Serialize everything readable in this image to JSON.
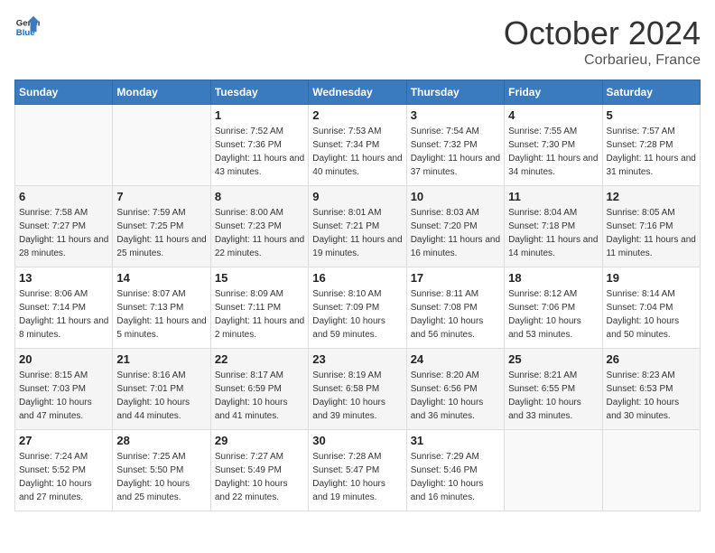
{
  "header": {
    "logo_line1": "General",
    "logo_line2": "Blue",
    "month": "October 2024",
    "location": "Corbarieu, France"
  },
  "weekdays": [
    "Sunday",
    "Monday",
    "Tuesday",
    "Wednesday",
    "Thursday",
    "Friday",
    "Saturday"
  ],
  "weeks": [
    [
      {
        "day": "",
        "sunrise": "",
        "sunset": "",
        "daylight": ""
      },
      {
        "day": "",
        "sunrise": "",
        "sunset": "",
        "daylight": ""
      },
      {
        "day": "1",
        "sunrise": "Sunrise: 7:52 AM",
        "sunset": "Sunset: 7:36 PM",
        "daylight": "Daylight: 11 hours and 43 minutes."
      },
      {
        "day": "2",
        "sunrise": "Sunrise: 7:53 AM",
        "sunset": "Sunset: 7:34 PM",
        "daylight": "Daylight: 11 hours and 40 minutes."
      },
      {
        "day": "3",
        "sunrise": "Sunrise: 7:54 AM",
        "sunset": "Sunset: 7:32 PM",
        "daylight": "Daylight: 11 hours and 37 minutes."
      },
      {
        "day": "4",
        "sunrise": "Sunrise: 7:55 AM",
        "sunset": "Sunset: 7:30 PM",
        "daylight": "Daylight: 11 hours and 34 minutes."
      },
      {
        "day": "5",
        "sunrise": "Sunrise: 7:57 AM",
        "sunset": "Sunset: 7:28 PM",
        "daylight": "Daylight: 11 hours and 31 minutes."
      }
    ],
    [
      {
        "day": "6",
        "sunrise": "Sunrise: 7:58 AM",
        "sunset": "Sunset: 7:27 PM",
        "daylight": "Daylight: 11 hours and 28 minutes."
      },
      {
        "day": "7",
        "sunrise": "Sunrise: 7:59 AM",
        "sunset": "Sunset: 7:25 PM",
        "daylight": "Daylight: 11 hours and 25 minutes."
      },
      {
        "day": "8",
        "sunrise": "Sunrise: 8:00 AM",
        "sunset": "Sunset: 7:23 PM",
        "daylight": "Daylight: 11 hours and 22 minutes."
      },
      {
        "day": "9",
        "sunrise": "Sunrise: 8:01 AM",
        "sunset": "Sunset: 7:21 PM",
        "daylight": "Daylight: 11 hours and 19 minutes."
      },
      {
        "day": "10",
        "sunrise": "Sunrise: 8:03 AM",
        "sunset": "Sunset: 7:20 PM",
        "daylight": "Daylight: 11 hours and 16 minutes."
      },
      {
        "day": "11",
        "sunrise": "Sunrise: 8:04 AM",
        "sunset": "Sunset: 7:18 PM",
        "daylight": "Daylight: 11 hours and 14 minutes."
      },
      {
        "day": "12",
        "sunrise": "Sunrise: 8:05 AM",
        "sunset": "Sunset: 7:16 PM",
        "daylight": "Daylight: 11 hours and 11 minutes."
      }
    ],
    [
      {
        "day": "13",
        "sunrise": "Sunrise: 8:06 AM",
        "sunset": "Sunset: 7:14 PM",
        "daylight": "Daylight: 11 hours and 8 minutes."
      },
      {
        "day": "14",
        "sunrise": "Sunrise: 8:07 AM",
        "sunset": "Sunset: 7:13 PM",
        "daylight": "Daylight: 11 hours and 5 minutes."
      },
      {
        "day": "15",
        "sunrise": "Sunrise: 8:09 AM",
        "sunset": "Sunset: 7:11 PM",
        "daylight": "Daylight: 11 hours and 2 minutes."
      },
      {
        "day": "16",
        "sunrise": "Sunrise: 8:10 AM",
        "sunset": "Sunset: 7:09 PM",
        "daylight": "Daylight: 10 hours and 59 minutes."
      },
      {
        "day": "17",
        "sunrise": "Sunrise: 8:11 AM",
        "sunset": "Sunset: 7:08 PM",
        "daylight": "Daylight: 10 hours and 56 minutes."
      },
      {
        "day": "18",
        "sunrise": "Sunrise: 8:12 AM",
        "sunset": "Sunset: 7:06 PM",
        "daylight": "Daylight: 10 hours and 53 minutes."
      },
      {
        "day": "19",
        "sunrise": "Sunrise: 8:14 AM",
        "sunset": "Sunset: 7:04 PM",
        "daylight": "Daylight: 10 hours and 50 minutes."
      }
    ],
    [
      {
        "day": "20",
        "sunrise": "Sunrise: 8:15 AM",
        "sunset": "Sunset: 7:03 PM",
        "daylight": "Daylight: 10 hours and 47 minutes."
      },
      {
        "day": "21",
        "sunrise": "Sunrise: 8:16 AM",
        "sunset": "Sunset: 7:01 PM",
        "daylight": "Daylight: 10 hours and 44 minutes."
      },
      {
        "day": "22",
        "sunrise": "Sunrise: 8:17 AM",
        "sunset": "Sunset: 6:59 PM",
        "daylight": "Daylight: 10 hours and 41 minutes."
      },
      {
        "day": "23",
        "sunrise": "Sunrise: 8:19 AM",
        "sunset": "Sunset: 6:58 PM",
        "daylight": "Daylight: 10 hours and 39 minutes."
      },
      {
        "day": "24",
        "sunrise": "Sunrise: 8:20 AM",
        "sunset": "Sunset: 6:56 PM",
        "daylight": "Daylight: 10 hours and 36 minutes."
      },
      {
        "day": "25",
        "sunrise": "Sunrise: 8:21 AM",
        "sunset": "Sunset: 6:55 PM",
        "daylight": "Daylight: 10 hours and 33 minutes."
      },
      {
        "day": "26",
        "sunrise": "Sunrise: 8:23 AM",
        "sunset": "Sunset: 6:53 PM",
        "daylight": "Daylight: 10 hours and 30 minutes."
      }
    ],
    [
      {
        "day": "27",
        "sunrise": "Sunrise: 7:24 AM",
        "sunset": "Sunset: 5:52 PM",
        "daylight": "Daylight: 10 hours and 27 minutes."
      },
      {
        "day": "28",
        "sunrise": "Sunrise: 7:25 AM",
        "sunset": "Sunset: 5:50 PM",
        "daylight": "Daylight: 10 hours and 25 minutes."
      },
      {
        "day": "29",
        "sunrise": "Sunrise: 7:27 AM",
        "sunset": "Sunset: 5:49 PM",
        "daylight": "Daylight: 10 hours and 22 minutes."
      },
      {
        "day": "30",
        "sunrise": "Sunrise: 7:28 AM",
        "sunset": "Sunset: 5:47 PM",
        "daylight": "Daylight: 10 hours and 19 minutes."
      },
      {
        "day": "31",
        "sunrise": "Sunrise: 7:29 AM",
        "sunset": "Sunset: 5:46 PM",
        "daylight": "Daylight: 10 hours and 16 minutes."
      },
      {
        "day": "",
        "sunrise": "",
        "sunset": "",
        "daylight": ""
      },
      {
        "day": "",
        "sunrise": "",
        "sunset": "",
        "daylight": ""
      }
    ]
  ]
}
